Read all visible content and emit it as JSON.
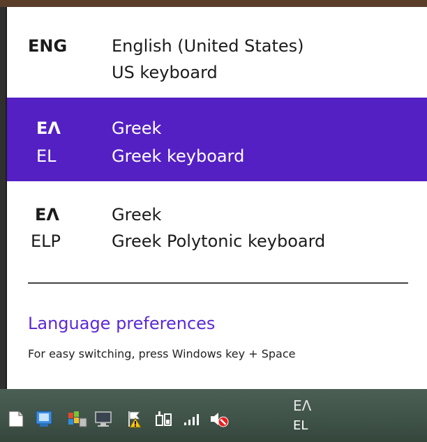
{
  "languages": [
    {
      "code_top": "ENG",
      "code_bottom": "",
      "name": "English (United States)",
      "keyboard": "US keyboard",
      "selected": false
    },
    {
      "code_top": "ΕΛ",
      "code_bottom": "EL",
      "name": "Greek",
      "keyboard": "Greek keyboard",
      "selected": true
    },
    {
      "code_top": "ΕΛ",
      "code_bottom": "ELP",
      "name": "Greek",
      "keyboard": "Greek Polytonic keyboard",
      "selected": false
    }
  ],
  "preferences_link": "Language preferences",
  "hint": "For easy switching, press Windows key + Space",
  "taskbar": {
    "ime_top": "ΕΛ",
    "ime_bottom": "EL",
    "icons": [
      "document-icon",
      "remote-app-icon",
      "colorful-app-icon",
      "network-computer-icon",
      "action-center-warning-icon",
      "power-icon",
      "signal-icon",
      "volume-muted-icon"
    ]
  },
  "colors": {
    "selection": "#5420c4",
    "link": "#5b28d6"
  }
}
